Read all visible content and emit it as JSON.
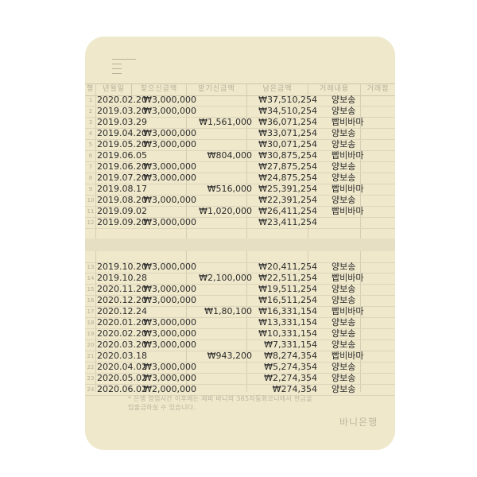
{
  "headers": [
    "행",
    "년월일",
    "찾으신금액",
    "맡기신금액",
    "남은금액",
    "거래내용",
    "거래점"
  ],
  "rows_top": [
    {
      "n": "1",
      "date": "2020.02.20",
      "withdraw": "₩3,000,000",
      "deposit": "",
      "balance": "₩37,510,254",
      "desc": "양보송"
    },
    {
      "n": "2",
      "date": "2019.03.20",
      "withdraw": "₩3,000,000",
      "deposit": "",
      "balance": "₩34,510,254",
      "desc": "양보송"
    },
    {
      "n": "3",
      "date": "2019.03.29",
      "withdraw": "",
      "deposit": "₩1,561,000",
      "balance": "₩36,071,254",
      "desc": "빱비바마"
    },
    {
      "n": "4",
      "date": "2019.04.20",
      "withdraw": "₩3,000,000",
      "deposit": "",
      "balance": "₩33,071,254",
      "desc": "양보송"
    },
    {
      "n": "5",
      "date": "2019.05.20",
      "withdraw": "₩3,000,000",
      "deposit": "",
      "balance": "₩30,071,254",
      "desc": "양보송"
    },
    {
      "n": "6",
      "date": "2019.06.05",
      "withdraw": "",
      "deposit": "₩804,000",
      "balance": "₩30,875,254",
      "desc": "빱비바마"
    },
    {
      "n": "7",
      "date": "2019.06.20",
      "withdraw": "₩3,000,000",
      "deposit": "",
      "balance": "₩27,875,254",
      "desc": "양보송"
    },
    {
      "n": "8",
      "date": "2019.07.20",
      "withdraw": "₩3,000,000",
      "deposit": "",
      "balance": "₩24,875,254",
      "desc": "양보송"
    },
    {
      "n": "9",
      "date": "2019.08.17",
      "withdraw": "",
      "deposit": "₩516,000",
      "balance": "₩25,391,254",
      "desc": "빱비바마"
    },
    {
      "n": "10",
      "date": "2019.08.20",
      "withdraw": "₩3,000,000",
      "deposit": "",
      "balance": "₩22,391,254",
      "desc": "양보송"
    },
    {
      "n": "11",
      "date": "2019.09.02",
      "withdraw": "",
      "deposit": "₩1,020,000",
      "balance": "₩26,411,254",
      "desc": "빱비바마"
    },
    {
      "n": "12",
      "date": "2019.09.20",
      "withdraw": "₩3,000,000",
      "deposit": "",
      "balance": "₩23,411,254",
      "desc": ""
    }
  ],
  "rows_bottom": [
    {
      "n": "13",
      "date": "2019.10.20",
      "withdraw": "₩3,000,000",
      "deposit": "",
      "balance": "₩20,411,254",
      "desc": "양보송"
    },
    {
      "n": "14",
      "date": "2019.10.28",
      "withdraw": "",
      "deposit": "₩2,100,000",
      "balance": "₩22,511,254",
      "desc": "빱비바마"
    },
    {
      "n": "15",
      "date": "2020.11.20",
      "withdraw": "₩3,000,000",
      "deposit": "",
      "balance": "₩19,511,254",
      "desc": "양보송"
    },
    {
      "n": "16",
      "date": "2020.12.20",
      "withdraw": "₩3,000,000",
      "deposit": "",
      "balance": "₩16,511,254",
      "desc": "양보송"
    },
    {
      "n": "17",
      "date": "2020.12.24",
      "withdraw": "",
      "deposit": "₩1,80,100",
      "balance": "₩16,331,154",
      "desc": "빱비바마"
    },
    {
      "n": "18",
      "date": "2020.01.20",
      "withdraw": "₩3,000,000",
      "deposit": "",
      "balance": "₩13,331,154",
      "desc": "양보송"
    },
    {
      "n": "19",
      "date": "2020.02.20",
      "withdraw": "₩3,000,000",
      "deposit": "",
      "balance": "₩10,331,154",
      "desc": "양보송"
    },
    {
      "n": "20",
      "date": "2020.03.20",
      "withdraw": "₩3,000,000",
      "deposit": "",
      "balance": "₩7,331,154",
      "desc": "양보송"
    },
    {
      "n": "21",
      "date": "2020.03.18",
      "withdraw": "",
      "deposit": "₩943,200",
      "balance": "₩8,274,354",
      "desc": "빱비바마"
    },
    {
      "n": "22",
      "date": "2020.04.02",
      "withdraw": "₩3,000,000",
      "deposit": "",
      "balance": "₩5,274,354",
      "desc": "양보송"
    },
    {
      "n": "23",
      "date": "2020.05.02",
      "withdraw": "₩3,000,000",
      "deposit": "",
      "balance": "₩2,274,354",
      "desc": "양보송"
    },
    {
      "n": "24",
      "date": "2020.06.02",
      "withdraw": "₩2,000,000",
      "deposit": "",
      "balance": "₩274,354",
      "desc": "양보송"
    }
  ],
  "note_line1": "* 은행 영업시간 이후에는 재퍼 바니의 365자동화코너에서 현금을",
  "note_line2": "입출금하실 수 있습니다.",
  "bank_name": "바니은행",
  "menu_icon": "menu-icon"
}
